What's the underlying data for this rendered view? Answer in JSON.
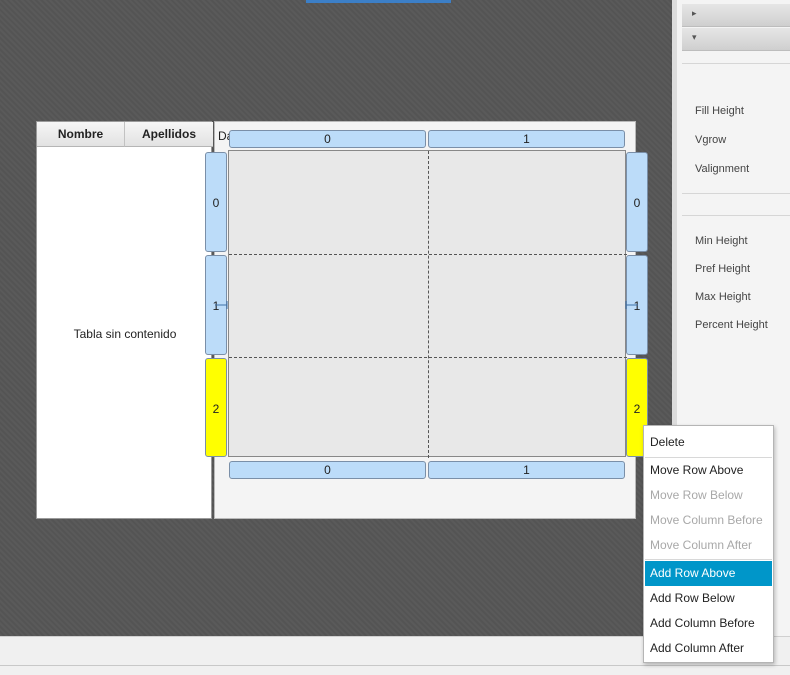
{
  "table": {
    "columns": [
      "Nombre",
      "Apellidos"
    ],
    "placeholder": "Tabla sin contenido"
  },
  "grid": {
    "host_label_fragment": "Da",
    "column_indices": [
      "0",
      "1"
    ],
    "row_indices": [
      "0",
      "1",
      "2"
    ],
    "selected_row": "2"
  },
  "inspector": {
    "section_arrows": [
      "▸",
      "▾"
    ],
    "layout_props": [
      "Fill Height",
      "Vgrow",
      "Valignment"
    ],
    "size_props": [
      "Min Height",
      "Pref Height",
      "Max Height",
      "Percent Height"
    ]
  },
  "context_menu": {
    "items": [
      {
        "label": "Delete",
        "enabled": true
      },
      {
        "label": "Move Row Above",
        "enabled": true
      },
      {
        "label": "Move Row Below",
        "enabled": false
      },
      {
        "label": "Move Column Before",
        "enabled": false
      },
      {
        "label": "Move Column After",
        "enabled": false
      },
      {
        "label": "Add Row Above",
        "enabled": true,
        "highlighted": true
      },
      {
        "label": "Add Row Below",
        "enabled": true
      },
      {
        "label": "Add Column Before",
        "enabled": true
      },
      {
        "label": "Add Column After",
        "enabled": true
      }
    ]
  },
  "colors": {
    "header_fill": "#bcdcf9",
    "selected_row_fill": "#ffff00",
    "menu_highlight": "#0096c9"
  }
}
